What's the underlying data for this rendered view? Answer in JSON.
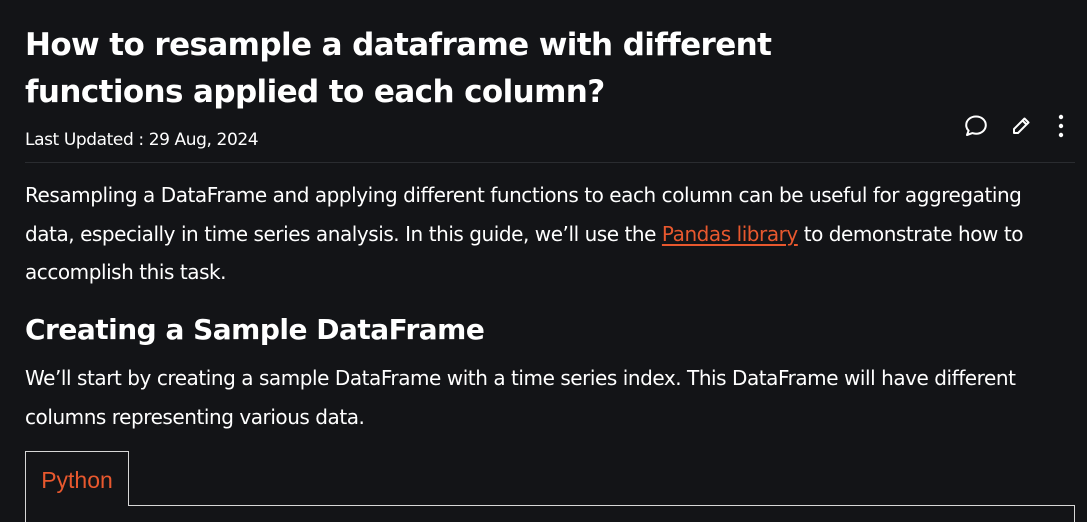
{
  "article": {
    "title": "How to resample a dataframe with different functions applied to each column?",
    "last_updated_label": "Last Updated : 29 Aug, 2024",
    "intro": {
      "before_link": "Resampling a DataFrame and applying different functions to each column can be useful for aggregating data, especially in time series analysis. In this guide, we’ll use the ",
      "link_text": "Pandas library",
      "after_link": " to demonstrate how to accomplish this task."
    },
    "section_heading": "Creating a Sample DataFrame",
    "section_paragraph": "We’ll start by creating a sample DataFrame with a time series index. This DataFrame will have different columns representing various data.",
    "code_tab_label": "Python"
  },
  "actions": {
    "comment_icon": "comment-icon",
    "edit_icon": "edit-icon",
    "more_icon": "more-vertical-icon"
  },
  "colors": {
    "background": "#131417",
    "text": "#ffffff",
    "link": "#e8582e",
    "divider": "#2a2c30",
    "code_border": "#d7d7d7"
  }
}
